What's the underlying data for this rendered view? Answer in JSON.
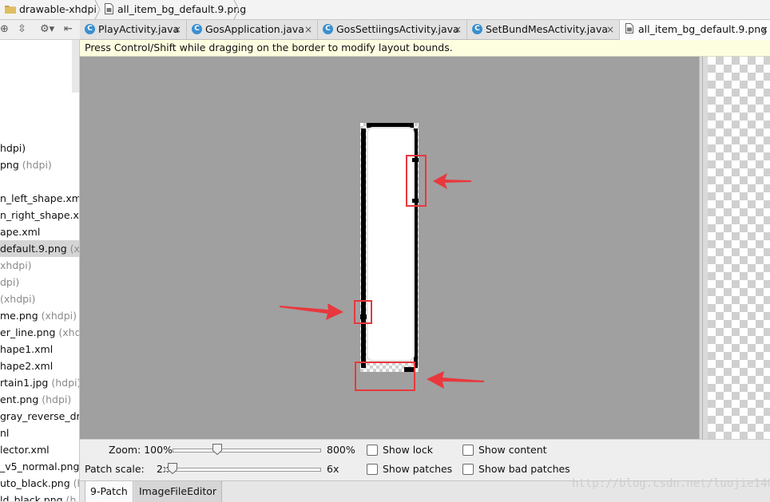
{
  "breadcrumb": {
    "folder": "drawable-xhdpi",
    "file": "all_item_bg_default.9.png"
  },
  "tabs": [
    {
      "label": "PlayActivity.java",
      "type": "class"
    },
    {
      "label": "GosApplication.java",
      "type": "class"
    },
    {
      "label": "GosSettiingsActivity.java",
      "type": "class"
    },
    {
      "label": "SetBundMesActivity.java",
      "type": "class"
    },
    {
      "label": "all_item_bg_default.9.png",
      "type": "image",
      "active": true
    }
  ],
  "tab_close_glyph": "×",
  "class_icon_letter": "C",
  "tree": {
    "items": [
      {
        "name": "hdpi)",
        "qualifier": ""
      },
      {
        "name": "png",
        "qualifier": " (hdpi)"
      },
      {
        "name": "n_left_shape.xml",
        "qualifier": ""
      },
      {
        "name": "n_right_shape.xml",
        "qualifier": ""
      },
      {
        "name": "ape.xml",
        "qualifier": ""
      },
      {
        "name": "default.9.png",
        "qualifier": " (xhd"
      },
      {
        "name": "xhdpi)",
        "qualifier": ""
      },
      {
        "name": "dpi)",
        "qualifier": ""
      },
      {
        "name": " (xhdpi)",
        "qualifier": ""
      },
      {
        "name": "me.png",
        "qualifier": " (xhdpi)"
      },
      {
        "name": "er_line.png",
        "qualifier": " (xhdp"
      },
      {
        "name": "hape1.xml",
        "qualifier": ""
      },
      {
        "name": "hape2.xml",
        "qualifier": ""
      },
      {
        "name": "rtain1.jpg",
        "qualifier": " (hdpi)"
      },
      {
        "name": "ent.png",
        "qualifier": " (hdpi)"
      },
      {
        "name": "gray_reverse_draw",
        "qualifier": ""
      },
      {
        "name": "nl",
        "qualifier": ""
      },
      {
        "name": "lector.xml",
        "qualifier": ""
      },
      {
        "name": "_v5_normal.png",
        "qualifier": " (h"
      },
      {
        "name": "uto_black.png",
        "qualifier": " (hd"
      },
      {
        "name": "ld_black.png",
        "qualifier": " (h"
      }
    ]
  },
  "hint": "Press Control/Shift while dragging on the border to modify layout bounds.",
  "controls": {
    "zoom_label": "Zoom: 100%",
    "zoom_max": "800%",
    "zoom_value": 0.28,
    "patch_scale_label": "Patch scale:",
    "patch_scale_min": "2x",
    "patch_scale_max": "6x",
    "patch_scale_value": 0.0,
    "checkboxes": [
      {
        "label": "Show lock",
        "checked": false
      },
      {
        "label": "Show content",
        "checked": false
      },
      {
        "label": "Show patches",
        "checked": false
      },
      {
        "label": "Show bad patches",
        "checked": false
      }
    ]
  },
  "bottom_tabs": [
    {
      "label": "9-Patch",
      "active": true
    },
    {
      "label": "ImageFileEditor",
      "active": false
    }
  ],
  "watermark": "http://blog.csdn.net/luojie140",
  "colors": {
    "highlight": "#e8383d",
    "canvas": "#a0a0a0",
    "hint_bg": "#fdfde0"
  }
}
